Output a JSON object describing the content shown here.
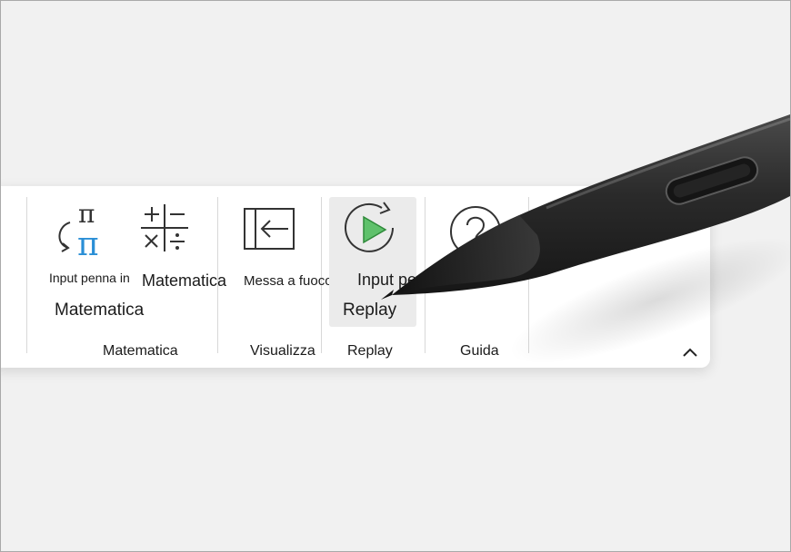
{
  "ribbon": {
    "buttons": {
      "ink_to_math_line1": "Input penna in",
      "ink_to_math_line2": "Matematica",
      "math": "Matematica",
      "focus": "Messa a fuoco",
      "ink_replay_line1": "Input penna",
      "ink_replay_line2": "Replay"
    },
    "groups": {
      "math": "Matematica",
      "view": "Visualizza",
      "replay": "Replay",
      "help": "Guida"
    }
  },
  "icons": {
    "ink_to_math": "pi-conversion-icon",
    "math": "math-operators-icon",
    "focus": "focus-mode-icon",
    "ink_replay": "replay-play-icon",
    "help": "help-question-icon",
    "collapse": "chevron-up-icon"
  },
  "colors": {
    "accent_blue": "#2b8fd6",
    "replay_green": "#4db35a",
    "highlight": "#ebebeb"
  }
}
